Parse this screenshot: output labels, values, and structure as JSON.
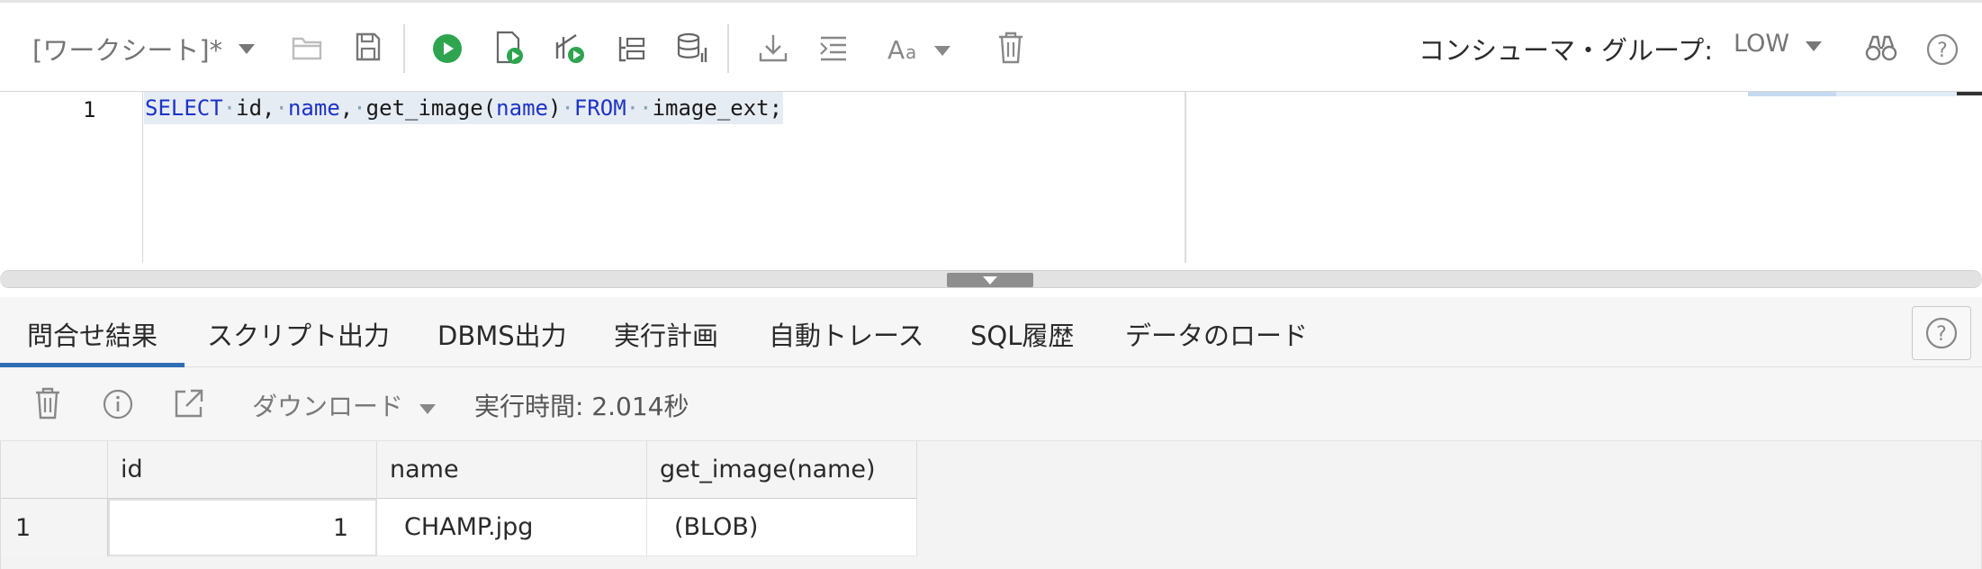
{
  "toolbar": {
    "worksheet_label": "[ワークシート]*",
    "consumer_group_label": "コンシューマ・グループ:",
    "consumer_group_value": "LOW",
    "icons": [
      "open-folder-icon",
      "save-icon",
      "run-statement-icon",
      "run-script-icon",
      "explain-plan-icon",
      "autotrace-icon",
      "sql-tuning-icon",
      "download-icon",
      "format-icon",
      "font-size-icon",
      "clear-icon",
      "find-icon",
      "help-icon"
    ],
    "colors": {
      "run_green": "#2ea44f"
    }
  },
  "editor": {
    "line_number": "1",
    "code_tokens": [
      {
        "t": "SELECT",
        "kw": true
      },
      {
        "t": "·",
        "ws": true
      },
      {
        "t": "id,",
        "kw": false
      },
      {
        "t": "·",
        "ws": true
      },
      {
        "t": "name",
        "kw": true
      },
      {
        "t": ",",
        "kw": false
      },
      {
        "t": "·",
        "ws": true
      },
      {
        "t": "get_image(",
        "kw": false
      },
      {
        "t": "name",
        "kw": true
      },
      {
        "t": ")",
        "kw": false
      },
      {
        "t": "·",
        "ws": true
      },
      {
        "t": "FROM",
        "kw": true
      },
      {
        "t": "··",
        "ws": true
      },
      {
        "t": "image_ext;",
        "kw": false
      }
    ]
  },
  "results": {
    "tabs": [
      {
        "label": "問合せ結果",
        "active": true
      },
      {
        "label": "スクリプト出力",
        "active": false
      },
      {
        "label": "DBMS出力",
        "active": false
      },
      {
        "label": "実行計画",
        "active": false
      },
      {
        "label": "自動トレース",
        "active": false
      },
      {
        "label": "SQL履歴",
        "active": false
      },
      {
        "label": "データのロード",
        "active": false
      }
    ],
    "accent_color": "#2f6db5",
    "download_label": "ダウンロード",
    "exec_time": "実行時間: 2.014秒",
    "table": {
      "columns": [
        "id",
        "name",
        "get_image(name)"
      ],
      "rows": [
        {
          "row_num": "1",
          "cells": [
            "1",
            "CHAMP.jpg",
            "(BLOB)"
          ]
        }
      ]
    }
  }
}
